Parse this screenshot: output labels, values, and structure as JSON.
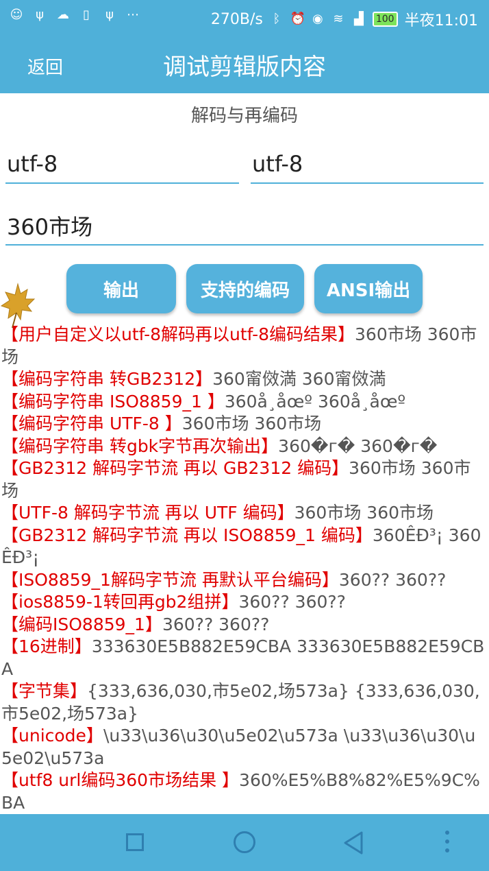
{
  "status_bar": {
    "left_icons": [
      "smiley-face-icon",
      "usb-icon",
      "weather-cloud-icon",
      "document-icon",
      "usb-icon",
      "more-dots-icon"
    ],
    "net_speed": "270B/s",
    "battery": "100",
    "time": "半夜11:01"
  },
  "app_bar": {
    "back_label": "返回",
    "title": "调试剪辑版内容"
  },
  "subtitle": "解码与再编码",
  "inputs": {
    "decode_charset": "utf-8",
    "encode_charset": "utf-8",
    "text": "360市场"
  },
  "buttons": {
    "output": "输出",
    "supported_encodings": "支持的编码",
    "ansi_output": "ANSI输出"
  },
  "results": [
    {
      "label": "【用户自定义以utf-8解码再以utf-8编码结果】",
      "value": "360市场 360市场"
    },
    {
      "label": "【编码字符串 转GB2312】",
      "value": "360甯傚満 360甯傚満"
    },
    {
      "label": "【编码字符串 ISO8859_1 】",
      "value": "360å¸åœº 360å¸åœº"
    },
    {
      "label": "【编码字符串 UTF-8 】",
      "value": "360市场 360市场"
    },
    {
      "label": "【编码字符串 转gbk字节再次输出】",
      "value": "360�г� 360�г�"
    },
    {
      "label": "【GB2312 解码字节流 再以 GB2312 编码】",
      "value": "360市场 360市场"
    },
    {
      "label": "【UTF-8 解码字节流 再以 UTF 编码】",
      "value": "360市场 360市场"
    },
    {
      "label": "【GB2312 解码字节流 再以 ISO8859_1 编码】",
      "value": "360ÊÐ³¡ 360ÊÐ³¡"
    },
    {
      "label": "【ISO8859_1解码字节流 再默认平台编码】",
      "value": "360?? 360??"
    },
    {
      "label": "【ios8859-1转回再gb2组拼】",
      "value": "360?? 360??"
    },
    {
      "label": "【编码ISO8859_1】",
      "value": "360?? 360??"
    },
    {
      "label": "【16进制】",
      "value": "333630E5B882E59CBA 333630E5B882E59CBA"
    },
    {
      "label": "【字节集】",
      "value": "{333,636,030,市5e02,场573a} {333,636,030,市5e02,场573a}"
    },
    {
      "label": "【unicode】",
      "value": "\\u33\\u36\\u30\\u5e02\\u573a \\u33\\u36\\u30\\u5e02\\u573a"
    },
    {
      "label": "【utf8 url编码360市场结果 】",
      "value": "360%E5%B8%82%E5%9C%BA"
    }
  ],
  "nav_bar": {
    "icons": [
      "recent-apps-square-icon",
      "home-circle-icon",
      "back-triangle-icon",
      "menu-dots-icon"
    ]
  },
  "colors": {
    "primary": "#4fb0d9",
    "label_red": "#e00000",
    "text_gray": "#555555"
  }
}
